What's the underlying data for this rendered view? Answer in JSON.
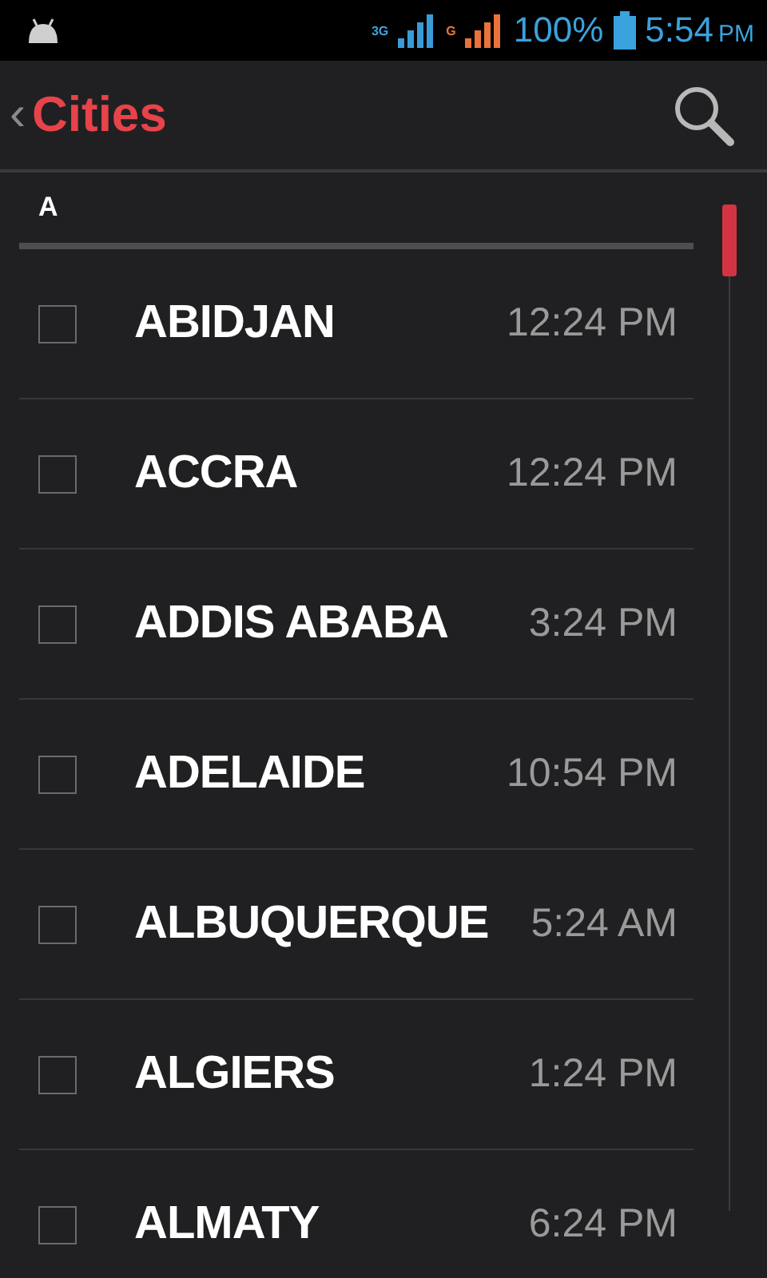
{
  "status_bar": {
    "network_3g": "3G",
    "network_g": "G",
    "battery": "100%",
    "time": "5:54",
    "meridiem": "PM"
  },
  "action_bar": {
    "back": "‹",
    "title": "Cities"
  },
  "section": {
    "header": "A"
  },
  "cities": [
    {
      "name": "ABIDJAN",
      "time": "12:24 PM",
      "checked": false
    },
    {
      "name": "ACCRA",
      "time": "12:24 PM",
      "checked": false
    },
    {
      "name": "ADDIS ABABA",
      "time": "3:24 PM",
      "checked": false
    },
    {
      "name": "ADELAIDE",
      "time": "10:54 PM",
      "checked": false
    },
    {
      "name": "ALBUQUERQUE",
      "time": "5:24 AM",
      "checked": false
    },
    {
      "name": "ALGIERS",
      "time": "1:24 PM",
      "checked": false
    },
    {
      "name": "ALMATY",
      "time": "6:24 PM",
      "checked": false
    }
  ]
}
